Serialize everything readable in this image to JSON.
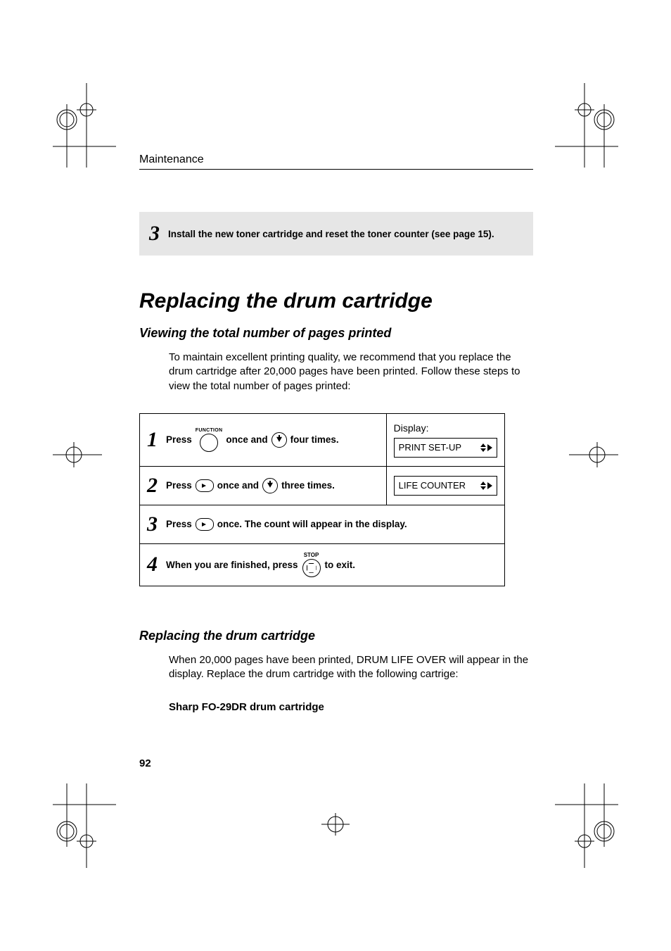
{
  "header_label": "Maintenance",
  "step3_box": {
    "num": "3",
    "text": "Install the new toner cartridge and reset the toner counter (see page 15)."
  },
  "title": "Replacing the drum cartridge",
  "subtitle1": "Viewing the total number of pages printed",
  "intro1": "To maintain excellent printing quality, we recommend that you replace the drum cartridge after 20,000 pages have been printed. Follow these steps to view the total number of pages printed:",
  "table": {
    "display_label": "Display:",
    "step1": {
      "num": "1",
      "press": "Press",
      "function_label": "FUNCTION",
      "once_and": " once and ",
      "four_times": " four times.",
      "display": "PRINT SET-UP"
    },
    "step2": {
      "num": "2",
      "press": "Press ",
      "once_and": " once and ",
      "three_times": " three times.",
      "display": "LIFE COUNTER"
    },
    "step3": {
      "num": "3",
      "press": "Press ",
      "rest": " once. The count will appear in the display."
    },
    "step4": {
      "num": "4",
      "before": "When you are finished, press ",
      "stop_label": "STOP",
      "after": " to exit."
    }
  },
  "subtitle2": "Replacing the drum cartridge",
  "intro2": "When 20,000 pages have been printed, DRUM LIFE OVER will appear in the display. Replace the drum cartridge with the following cartrige:",
  "product_line": "Sharp FO-29DR drum cartridge",
  "page_number": "92"
}
